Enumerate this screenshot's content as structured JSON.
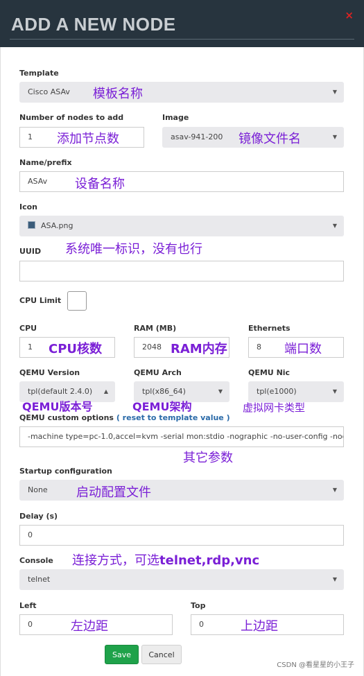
{
  "dialog": {
    "title": "ADD A NEW NODE",
    "close_icon": "×"
  },
  "template": {
    "label": "Template",
    "value": "Cisco ASAv",
    "note": "模板名称"
  },
  "nodes": {
    "label": "Number of nodes to add",
    "value": "1",
    "note": "添加节点数"
  },
  "image": {
    "label": "Image",
    "value": "asav-941-200",
    "note": "镜像文件名"
  },
  "name": {
    "label": "Name/prefix",
    "value": "ASAv",
    "note": "设备名称"
  },
  "icon": {
    "label": "Icon",
    "value": "ASA.png",
    "icon_name": "image-file-icon"
  },
  "uuid": {
    "label": "UUID",
    "value": "",
    "note": "系统唯一标识，没有也行"
  },
  "cpu_limit": {
    "label": "CPU Limit",
    "checked": false
  },
  "cpu": {
    "label": "CPU",
    "value": "1",
    "note": "CPU核数"
  },
  "ram": {
    "label": "RAM (MB)",
    "value": "2048",
    "note": "RAM内存"
  },
  "ethernets": {
    "label": "Ethernets",
    "value": "8",
    "note": "端口数"
  },
  "qemu_version": {
    "label": "QEMU Version",
    "value": "tpl(default 2.4.0)",
    "note": "QEMU版本号"
  },
  "qemu_arch": {
    "label": "QEMU Arch",
    "value": "tpl(x86_64)",
    "note": "QEMU架构"
  },
  "qemu_nic": {
    "label": "QEMU Nic",
    "value": "tpl(e1000)",
    "note": "虚拟网卡类型"
  },
  "qemu_options": {
    "label": "QEMU custom options",
    "reset_link": "( reset to template value )",
    "value": "-machine type=pc-1.0,accel=kvm -serial mon:stdio -nographic -no-user-config -nod",
    "note": "其它参数"
  },
  "startup": {
    "label": "Startup configuration",
    "value": "None",
    "note": "启动配置文件"
  },
  "delay": {
    "label": "Delay (s)",
    "value": "0"
  },
  "console": {
    "label": "Console",
    "value": "telnet",
    "note_prefix": "连接方式，可选",
    "note_suffix": "telnet,rdp,vnc"
  },
  "left": {
    "label": "Left",
    "value": "0",
    "note": "左边距"
  },
  "top": {
    "label": "Top",
    "value": "0",
    "note": "上边距"
  },
  "buttons": {
    "save": "Save",
    "cancel": "Cancel"
  },
  "watermark": "CSDN @看星星的小王子"
}
